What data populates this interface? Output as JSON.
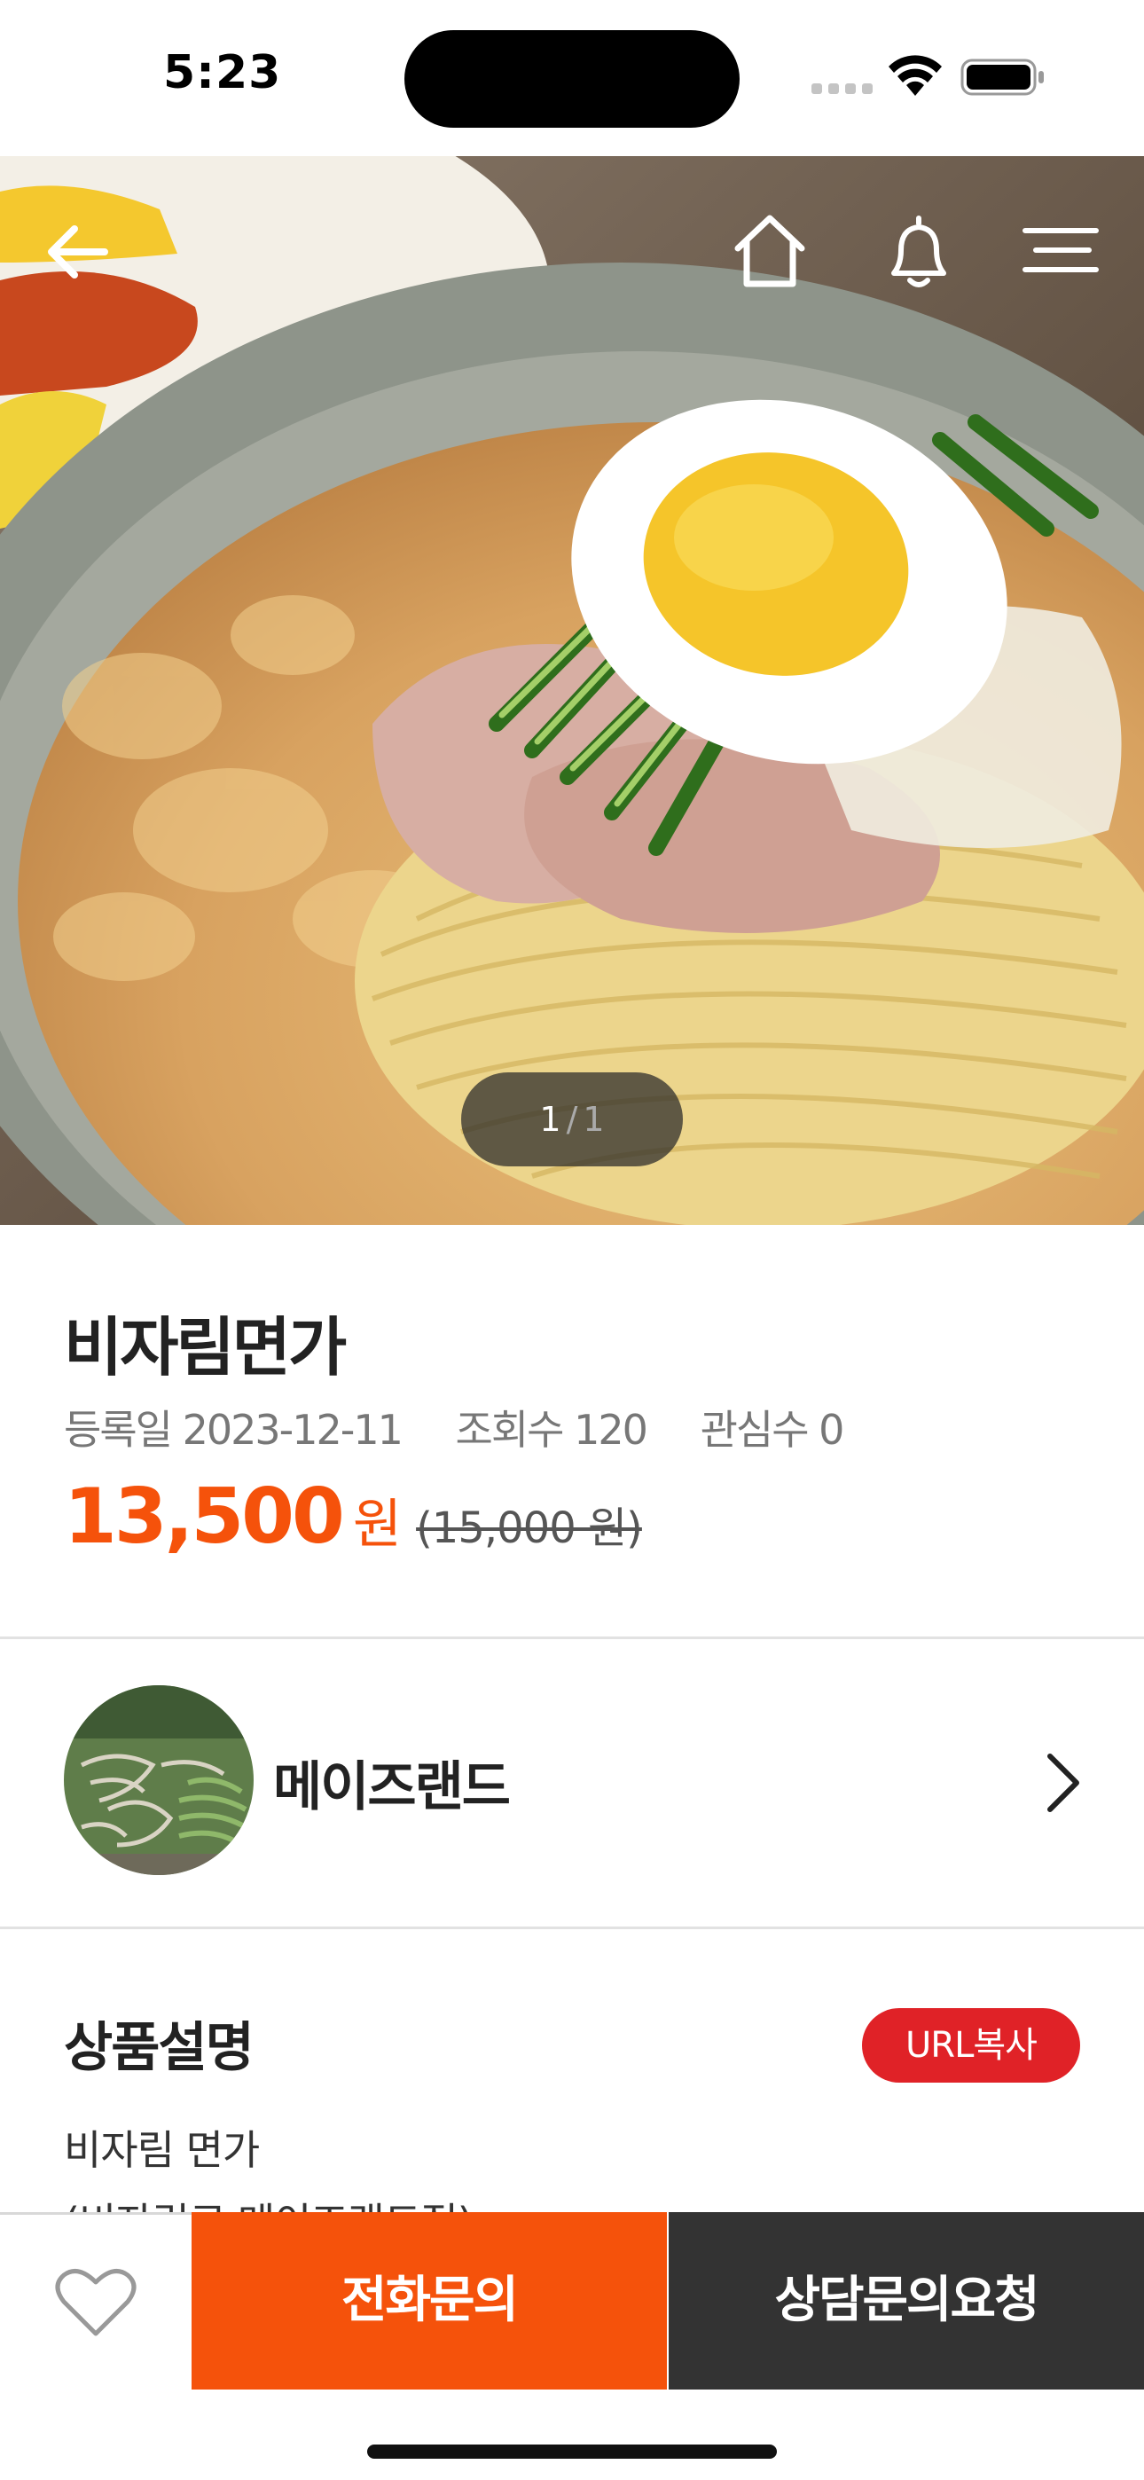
{
  "status_bar": {
    "time": "5:23"
  },
  "hero": {
    "pager": {
      "current": "1",
      "separator": "/",
      "total": "1"
    },
    "nav": [
      "back-arrow-icon",
      "home-icon",
      "bell-icon",
      "menu-icon"
    ]
  },
  "product": {
    "title": "비자림면가",
    "registered": "등록일 2023-12-11",
    "views": "조회수 120",
    "interest": "관심수 0",
    "price": "13,500",
    "price_unit": "원",
    "original_price": "(15,000 원)"
  },
  "seller": {
    "name": "메이즈랜드"
  },
  "description": {
    "title": "상품설명",
    "url_copy_label": "URL복사",
    "line1": "비자림 면가",
    "line2": "(비자림로 메이즈랜드점)"
  },
  "bottom_bar": {
    "call_label": "전화문의",
    "consult_label": "상담문의요청"
  },
  "colors": {
    "accent": "#f5520b",
    "url_button": "#e02227",
    "dark_button": "#333333"
  }
}
